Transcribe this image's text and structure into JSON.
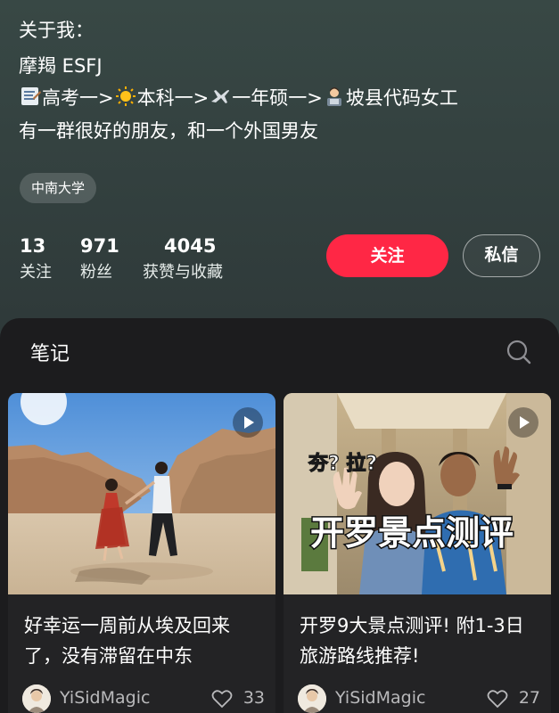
{
  "profile": {
    "bio_header": "关于我：",
    "mbti": "摩羯 ESFJ",
    "path": {
      "step1": "高考一>",
      "step2": "本科一>",
      "step3": "一年硕一>",
      "step4": "坡县代码女工"
    },
    "bio_friends": "有一群很好的朋友，和一个外国男友",
    "tag": "中南大学",
    "stats": [
      {
        "value": "13",
        "label": "关注"
      },
      {
        "value": "971",
        "label": "粉丝"
      },
      {
        "value": "4045",
        "label": "获赞与收藏"
      }
    ],
    "follow_label": "关注",
    "message_label": "私信",
    "follow_color": "#ff2745"
  },
  "notes": {
    "section_title": "笔记",
    "search_icon": "search-icon",
    "cards": [
      {
        "title": "好幸运一周前从埃及回来了，没有滞留在中东",
        "author": "YiSidMagic",
        "likes": "33",
        "image": "couple-walking-desert-canyon-photo",
        "video": true
      },
      {
        "title": "开罗9大景点测评! 附1-3日旅游路线推荐!",
        "author": "YiSidMagic",
        "likes": "27",
        "image": "couple-waving-selfie-photo",
        "overlay_big": "开罗景点测评",
        "overlay_small": "夯? 拉?",
        "video": true
      }
    ]
  }
}
